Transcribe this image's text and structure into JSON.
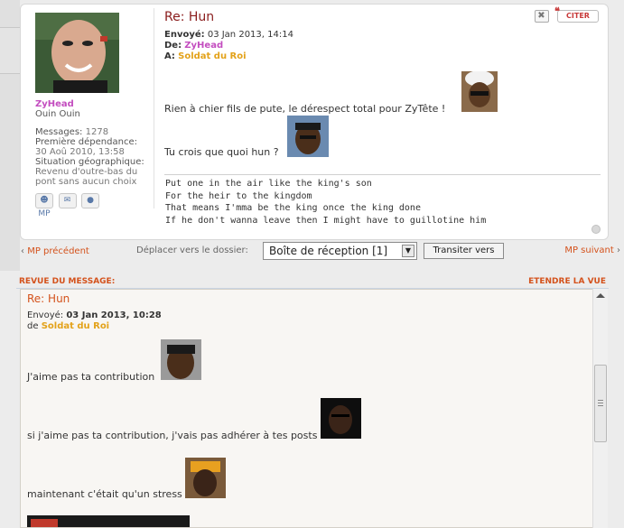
{
  "message": {
    "title": "Re: Hun",
    "sent_label": "Envoyé:",
    "sent_value": "03 Jan 2013, 14:14",
    "from_label": "De:",
    "from_name": "ZyHead",
    "to_label": "A:",
    "to_name": "Soldat du Roi",
    "line1": "Rien à chier fils de pute, le dérespect total pour ZyTête !",
    "line2": "Tu crois que quoi hun ?",
    "quote_button": "CITER",
    "quote_mark": "❝",
    "close_button": "✖",
    "signature": [
      "Put one in the air like the king's son",
      "For the heir to the kingdom",
      "That means I'mma be the king once the king done",
      "If he don't wanna leave then I might have to guillotine him"
    ]
  },
  "profile": {
    "username": "ZyHead",
    "user_title": "Ouin Ouin",
    "messages_label": "Messages:",
    "messages_value": "1278",
    "first_label": "Première dépendance:",
    "first_value": "30 Aoû 2010, 13:58",
    "geo_label": "Situation géographique:",
    "geo_value": "Revenu d'outre-bas du pont sans aucun choix",
    "icons": [
      "pm-icon",
      "email-icon",
      "website-icon"
    ],
    "pm_text": "MP"
  },
  "nav": {
    "prev_arrow": "‹",
    "prev_label": "MP précédent",
    "move_label": "Déplacer vers le dossier:",
    "folder_selected": "Boîte de réception [1]",
    "transfer_label": "Transiter vers",
    "next_label": "MP suivant",
    "next_arrow": "›"
  },
  "review": {
    "header_left": "REVUE DU MESSAGE:",
    "header_right": "ETENDRE LA VUE",
    "title": "Re: Hun",
    "sent_label": "Envoyé:",
    "sent_value": "03 Jan 2013, 10:28",
    "from_label": "de",
    "from_name": "Soldat du Roi",
    "line1": "J'aime pas ta contribution",
    "line2": "si j'aime pas ta contribution, j'vais pas adhérer à tes posts",
    "line3": "maintenant c'était qu'un stress"
  },
  "colors": {
    "title_red": "#8a1c1c",
    "accent_orange": "#d4521c",
    "username_magenta": "#c34dbf",
    "recipient_gold": "#e3a21a"
  }
}
